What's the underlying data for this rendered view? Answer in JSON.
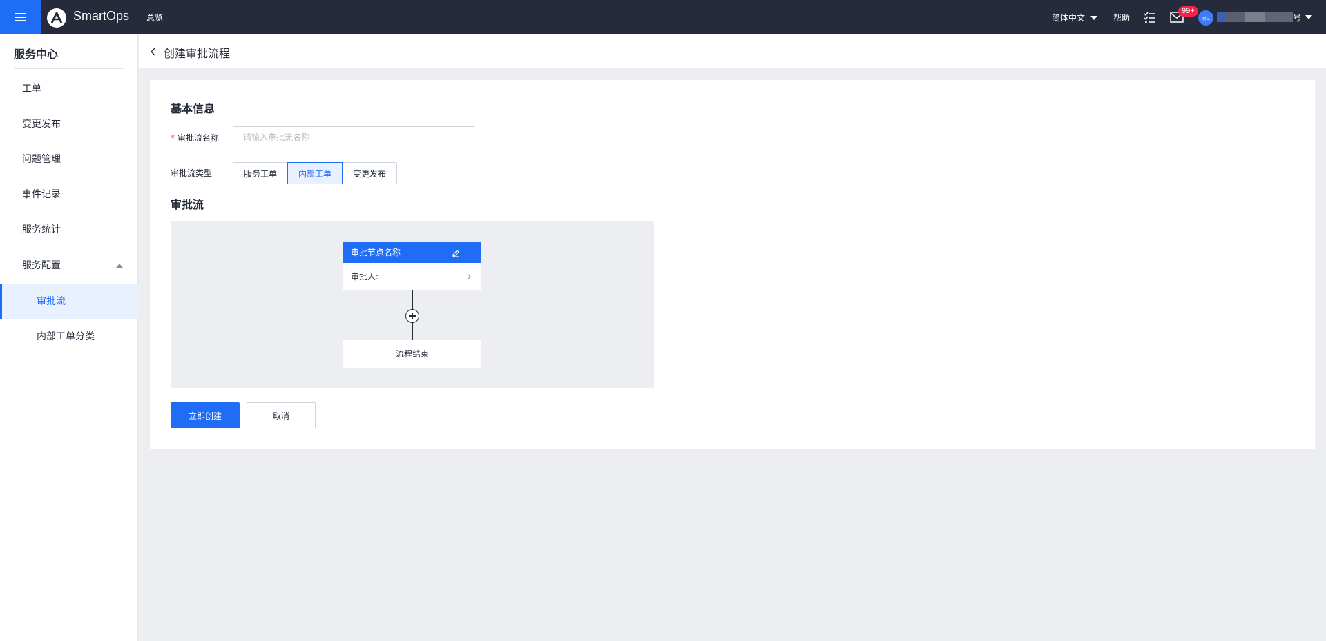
{
  "topbar": {
    "brand": "SmartOps",
    "nav_overview": "总览",
    "language": "简体中文",
    "help": "帮助",
    "mail_badge": "99+",
    "avatar_text": "测试",
    "username_tail": "号"
  },
  "sidebar": {
    "title": "服务中心",
    "items": [
      {
        "label": "工单"
      },
      {
        "label": "变更发布"
      },
      {
        "label": "问题管理"
      },
      {
        "label": "事件记录"
      },
      {
        "label": "服务统计"
      },
      {
        "label": "服务配置"
      },
      {
        "label": "审批流"
      },
      {
        "label": "内部工单分类"
      }
    ]
  },
  "page": {
    "title": "创建审批流程"
  },
  "form": {
    "basic_section": "基本信息",
    "name_required_mark": "*",
    "name_label": "审批流名称",
    "name_value": "",
    "name_placeholder": "请输入审批流名称",
    "type_label": "审批流类型",
    "types": [
      "服务工单",
      "内部工单",
      "变更发布"
    ],
    "selected_type": "内部工单",
    "flow_section": "审批流"
  },
  "flow": {
    "node_title": "审批节点名称",
    "approver_label": "审批人:",
    "end_label": "流程结束"
  },
  "actions": {
    "create": "立即创建",
    "cancel": "取消"
  },
  "colors": {
    "accent": "#1f6cf5",
    "topbar": "#252b3a",
    "badge": "#f5224e"
  }
}
